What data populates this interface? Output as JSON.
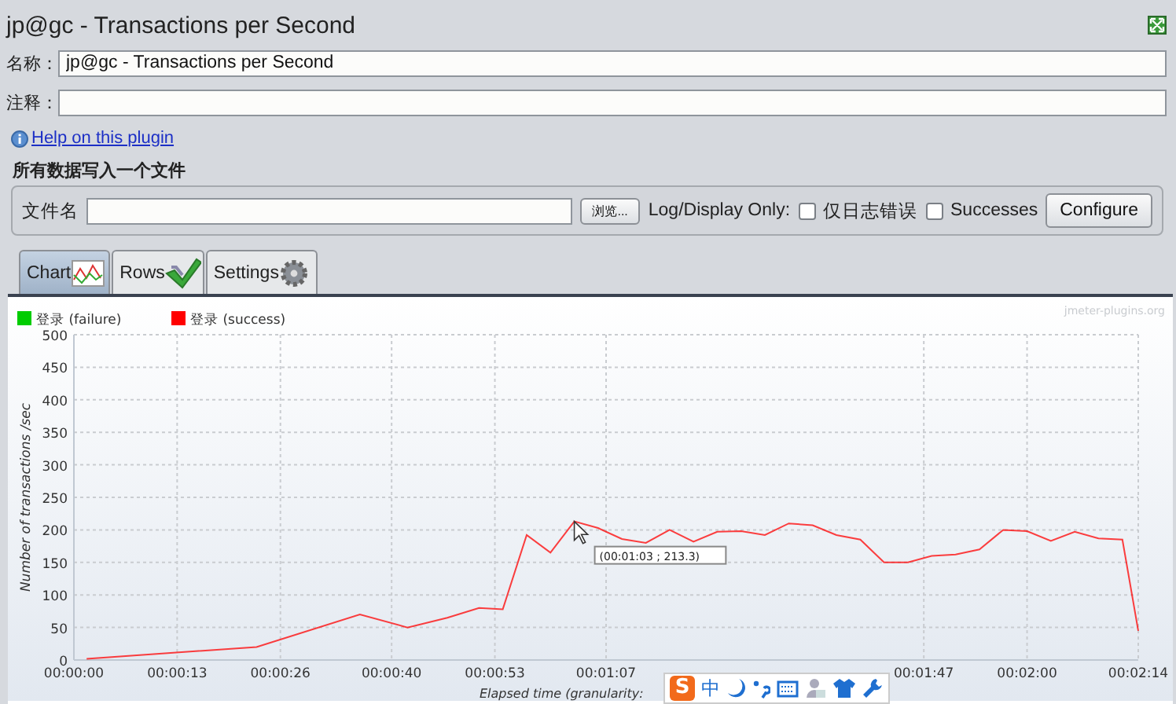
{
  "window": {
    "title": "jp@gc - Transactions per Second"
  },
  "name_field": {
    "label": "名称：",
    "value": "jp@gc - Transactions per Second"
  },
  "comment_field": {
    "label": "注释："
  },
  "help_link": "Help on this plugin",
  "file_section": {
    "title": "所有数据写入一个文件",
    "file_label": "文件名",
    "browse_button": "浏览...",
    "log_display_label": "Log/Display Only:",
    "checkboxes": [
      {
        "label": "仅日志错误",
        "checked": false
      },
      {
        "label": "Successes",
        "checked": false
      }
    ],
    "configure_button": "Configure"
  },
  "tabs": [
    {
      "label": "Chart",
      "selected": true
    },
    {
      "label": "Rows",
      "selected": false
    },
    {
      "label": "Settings",
      "selected": false
    }
  ],
  "chart": {
    "watermark": "jmeter-plugins.org",
    "chart_data": {
      "type": "line",
      "xlabel": "Elapsed time (granularity:",
      "ylabel": "Number of transactions /sec",
      "x": [
        1.6,
        23,
        36,
        42,
        47,
        51,
        54,
        57,
        60,
        63,
        66,
        69,
        72,
        75,
        78,
        81,
        84,
        87,
        90,
        93,
        96,
        99,
        102,
        105,
        108,
        111,
        114,
        117,
        120,
        123,
        126,
        129,
        132,
        134
      ],
      "series": [
        {
          "name": "登录 (failure)",
          "color": "#00cc00",
          "values": [
            null,
            null,
            null,
            null,
            null,
            null,
            null,
            null,
            null,
            null,
            null,
            null,
            null,
            null,
            null,
            null,
            null,
            null,
            null,
            null,
            null,
            null,
            null,
            null,
            null,
            null,
            null,
            null,
            null,
            null,
            null,
            null,
            null,
            null
          ]
        },
        {
          "name": "登录 (success)",
          "color": "#ff0000",
          "values": [
            2,
            20,
            70,
            50,
            65,
            80,
            78,
            192,
            165,
            213,
            203,
            186,
            180,
            200,
            182,
            197,
            198,
            192,
            210,
            207,
            192,
            185,
            150,
            150,
            160,
            162,
            170,
            200,
            198,
            183,
            197,
            187,
            185,
            45
          ]
        }
      ],
      "xlim": [
        0,
        134
      ],
      "ylim": [
        0,
        500
      ],
      "grid": true,
      "xticks": [
        {
          "value": 0,
          "label": "00:00:00"
        },
        {
          "value": 13,
          "label": "00:00:13"
        },
        {
          "value": 26,
          "label": "00:00:26"
        },
        {
          "value": 40,
          "label": "00:00:40"
        },
        {
          "value": 53,
          "label": "00:00:53"
        },
        {
          "value": 67,
          "label": "00:01:07"
        },
        {
          "value": 107,
          "label": "00:01:47"
        },
        {
          "value": 120,
          "label": "00:02:00"
        },
        {
          "value": 134,
          "label": "00:02:14"
        }
      ],
      "yticks": [
        0,
        50,
        100,
        150,
        200,
        250,
        300,
        350,
        400,
        450,
        500
      ],
      "annotations": [
        "(00:01:03 ; 213.3)"
      ]
    }
  },
  "ime_toolbar": {
    "logo": "S",
    "mode": "中"
  }
}
